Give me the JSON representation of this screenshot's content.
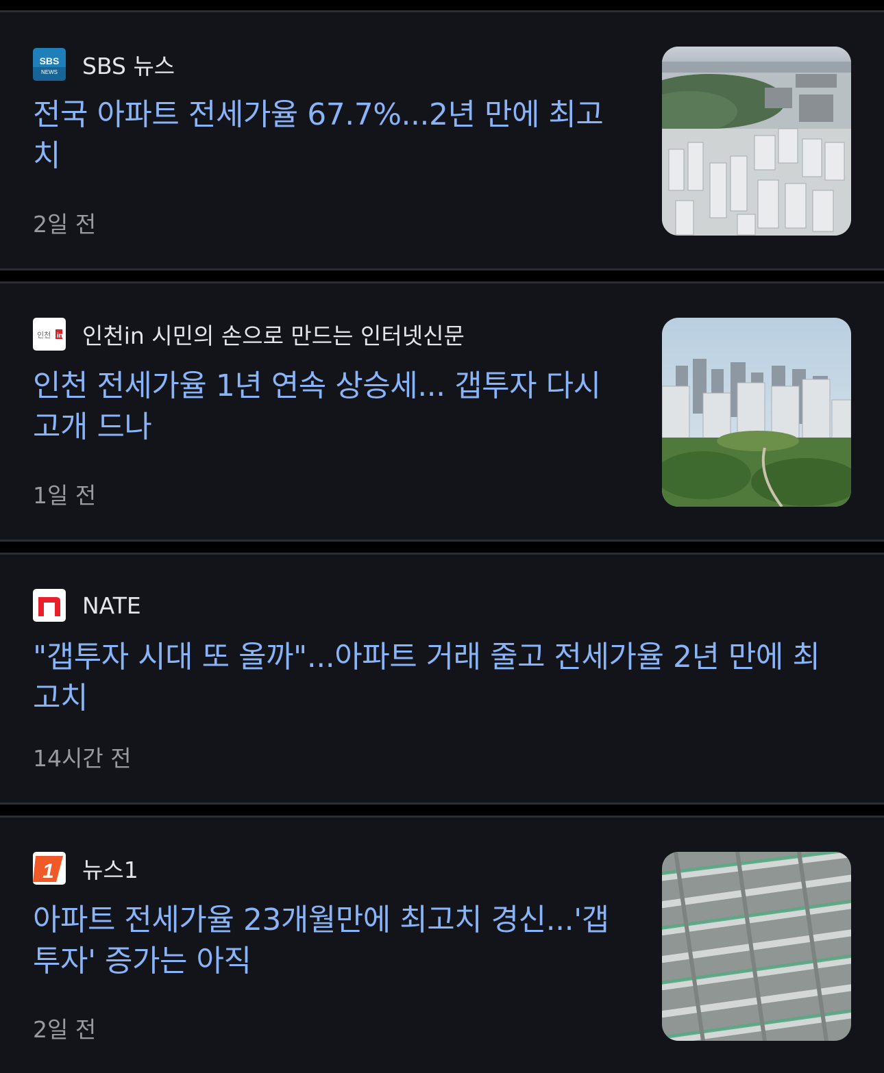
{
  "articles": [
    {
      "source": "SBS 뉴스",
      "logo_icon": "sbs-news-logo",
      "headline_line1": "전국 아파트 전세가율 67.7%...2년 만에 최고",
      "headline_line2": "치",
      "time": "2일 전",
      "thumbnail": "city-apartments-aerial-photo"
    },
    {
      "source": "인천in 시민의 손으로 만드는 인터넷신문",
      "logo_icon": "incheon-in-logo",
      "headline_line1": "인천 전세가율 1년 연속 상승세... 갭투자 다시",
      "headline_line2": "고개 드나",
      "time": "1일 전",
      "thumbnail": "high-rise-apartments-park-photo"
    },
    {
      "source": "NATE",
      "logo_icon": "nate-logo",
      "headline_line1": "\"갭투자 시대 또 올까\"...아파트 거래 줄고 전세가율 2년 만에 최",
      "headline_line2": "고치",
      "time": "14시간 전"
    },
    {
      "source": "뉴스1",
      "logo_icon": "news1-logo",
      "headline_line1": "아파트 전세가율 23개월만에 최고치 경신...'갭",
      "headline_line2": "투자' 증가는 아직",
      "time": "2일 전",
      "thumbnail": "apartment-blocks-aerial-photo"
    }
  ],
  "colors": {
    "background": "#000000",
    "card": "#131419",
    "headline": "#8ab4f8",
    "source_text": "#e4e5ea",
    "time_text": "#9a9ba1"
  }
}
